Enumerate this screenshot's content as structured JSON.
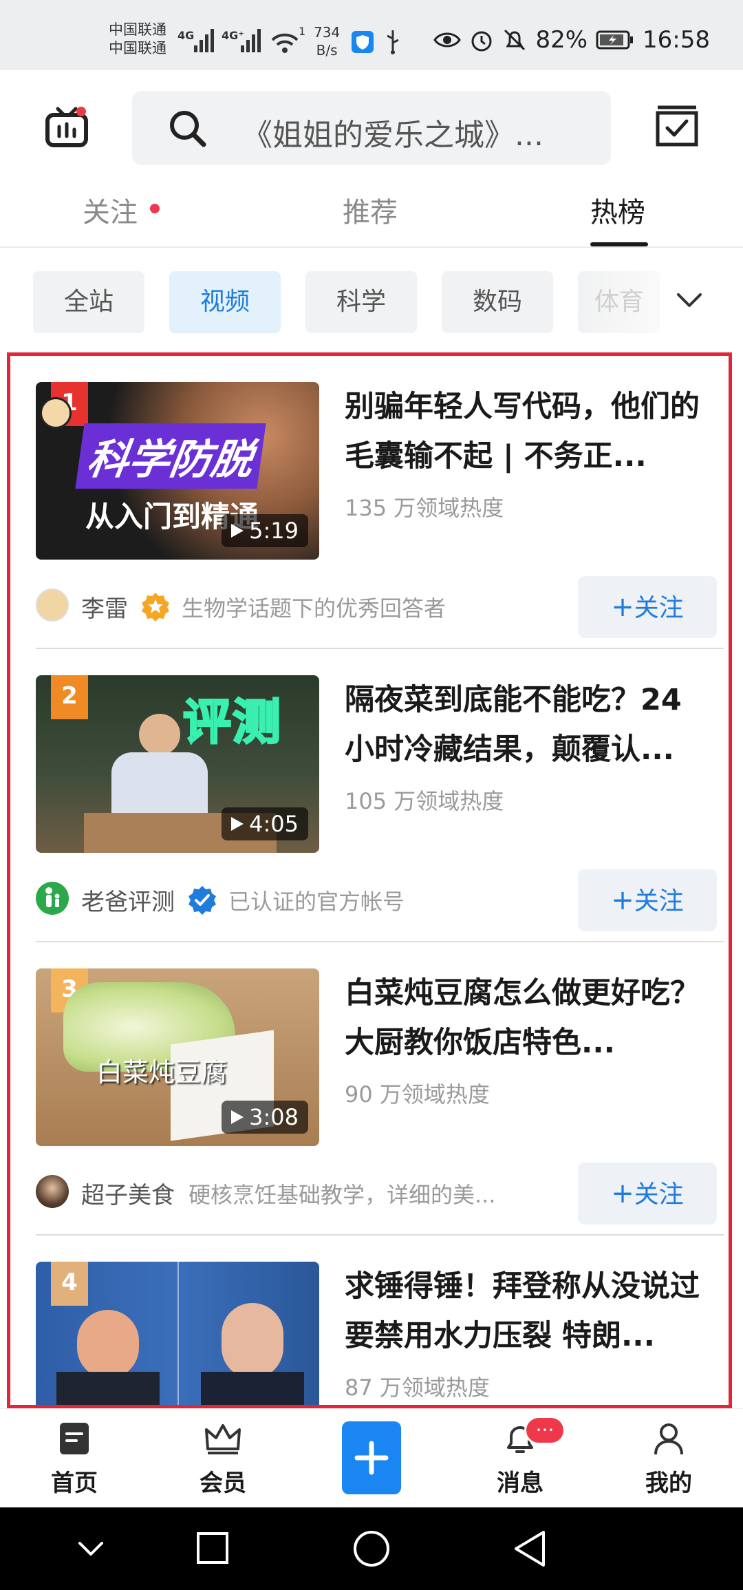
{
  "status_bar": {
    "carrier_1": "中国联通",
    "carrier_2": "中国联通",
    "net_1": "4G",
    "net_2": "4G⁺",
    "wifi_sub": "1",
    "speed_value": "734",
    "speed_unit": "B/s",
    "battery": "82%",
    "time": "16:58"
  },
  "header": {
    "search_placeholder": "《姐姐的爱乐之城》...",
    "tabs": [
      {
        "label": "关注",
        "has_dot": true
      },
      {
        "label": "推荐"
      },
      {
        "label": "热榜",
        "active": true
      }
    ]
  },
  "categories": {
    "items": [
      "全站",
      "视频",
      "科学",
      "数码",
      "体育"
    ],
    "active": "视频"
  },
  "feed": {
    "items": [
      {
        "rank": "1",
        "title": "别骗年轻人写代码，他们的毛囊输不起 | 不务正...",
        "heat": "135 万领域热度",
        "duration": "5:19",
        "thumb_caption_1": "科学防脱",
        "thumb_caption_2": "从入门到精通",
        "author": "李雷",
        "author_desc": "生物学话题下的优秀回答者",
        "follow": "关注"
      },
      {
        "rank": "2",
        "title": "隔夜菜到底能不能吃？24 小时冷藏结果，颠覆认...",
        "heat": "105 万领域热度",
        "duration": "4:05",
        "thumb_caption_1": "评测",
        "author": "老爸评测",
        "author_desc": "已认证的官方帐号",
        "follow": "关注"
      },
      {
        "rank": "3",
        "title": "白菜炖豆腐怎么做更好吃？大厨教你饭店特色...",
        "heat": "90 万领域热度",
        "duration": "3:08",
        "thumb_caption_1": "白菜炖豆腐",
        "author": "超子美食",
        "author_desc": "硬核烹饪基础教学，详细的美...",
        "follow": "关注"
      },
      {
        "rank": "4",
        "title": "求锤得锤！拜登称从没说过要禁用水力压裂 特朗...",
        "heat": "87 万领域热度"
      }
    ]
  },
  "bottom_nav": {
    "home": "首页",
    "vip": "会员",
    "messages": "消息",
    "message_badge": "···",
    "me": "我的"
  },
  "colors": {
    "accent_blue": "#1f7cdb",
    "highlight_red": "#e32636",
    "rank_1": "#e8322f",
    "rank_2": "#f08a24",
    "rank_3": "#f4b45b",
    "rank_4": "#e2b07a"
  }
}
